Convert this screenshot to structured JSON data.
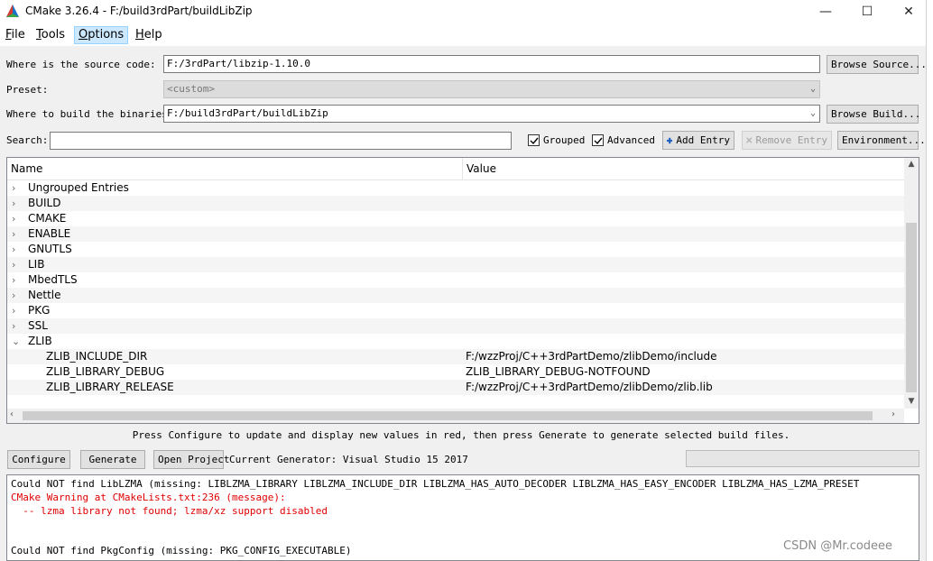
{
  "window": {
    "title": "CMake 3.26.4 - F:/build3rdPart/buildLibZip",
    "minimize": "—",
    "maximize": "☐",
    "close": "✕"
  },
  "menu": {
    "items": [
      {
        "label": "File",
        "u": "F",
        "rest": "ile"
      },
      {
        "label": "Tools",
        "u": "T",
        "rest": "ools"
      },
      {
        "label": "Options",
        "u": "O",
        "rest": "ptions"
      },
      {
        "label": "Help",
        "u": "H",
        "rest": "elp"
      }
    ],
    "active": "Options"
  },
  "form": {
    "source_label": "Where is the source code:",
    "source_value": "F:/3rdPart/libzip-1.10.0",
    "browse_source": "Browse Source...",
    "preset_label": "Preset:",
    "preset_value": "<custom>",
    "build_label": "Where to build the binaries:",
    "build_value": "F:/build3rdPart/buildLibZip",
    "browse_build": "Browse Build...",
    "search_label": "Search:",
    "search_value": ""
  },
  "toolbar": {
    "grouped_label": "Grouped",
    "grouped_checked": true,
    "advanced_label": "Advanced",
    "advanced_checked": true,
    "add_entry": "Add Entry",
    "remove_entry": "Remove Entry",
    "environment": "Environment..."
  },
  "tree": {
    "col_name": "Name",
    "col_value": "Value",
    "groups": [
      {
        "name": "Ungrouped Entries",
        "expanded": false
      },
      {
        "name": "BUILD",
        "expanded": false
      },
      {
        "name": "CMAKE",
        "expanded": false
      },
      {
        "name": "ENABLE",
        "expanded": false
      },
      {
        "name": "GNUTLS",
        "expanded": false
      },
      {
        "name": "LIB",
        "expanded": false
      },
      {
        "name": "MbedTLS",
        "expanded": false
      },
      {
        "name": "Nettle",
        "expanded": false
      },
      {
        "name": "PKG",
        "expanded": false
      },
      {
        "name": "SSL",
        "expanded": false
      },
      {
        "name": "ZLIB",
        "expanded": true
      }
    ],
    "entries": [
      {
        "name": "ZLIB_INCLUDE_DIR",
        "value": "F:/wzzProj/C++3rdPartDemo/zlibDemo/include"
      },
      {
        "name": "ZLIB_LIBRARY_DEBUG",
        "value": "ZLIB_LIBRARY_DEBUG-NOTFOUND"
      },
      {
        "name": "ZLIB_LIBRARY_RELEASE",
        "value": "F:/wzzProj/C++3rdPartDemo/zlibDemo/zlib.lib"
      }
    ]
  },
  "hint": "Press Configure to update and display new values in red, then press Generate to generate selected build files.",
  "actions": {
    "configure": "Configure",
    "generate": "Generate",
    "open_project": "Open Project",
    "generator_text": "Current Generator: Visual Studio 15 2017"
  },
  "output": {
    "lines": [
      {
        "text": "Could NOT find LibLZMA (missing: LIBLZMA_LIBRARY LIBLZMA_INCLUDE_DIR LIBLZMA_HAS_AUTO_DECODER LIBLZMA_HAS_EASY_ENCODER LIBLZMA_HAS_LZMA_PRESET",
        "red": false
      },
      {
        "text": "CMake Warning at CMakeLists.txt:236 (message):",
        "red": true
      },
      {
        "text": "  -- lzma library not found; lzma/xz support disabled",
        "red": true
      },
      {
        "text": "",
        "red": false
      },
      {
        "text": "",
        "red": false
      },
      {
        "text": "Could NOT find PkgConfig (missing: PKG_CONFIG_EXECUTABLE)",
        "red": false
      }
    ]
  },
  "watermark": "CSDN @Mr.codeee",
  "colors": {
    "warning": "#e00000",
    "menu_active": "#cce8ff",
    "add_icon": "#1e5fbf"
  }
}
